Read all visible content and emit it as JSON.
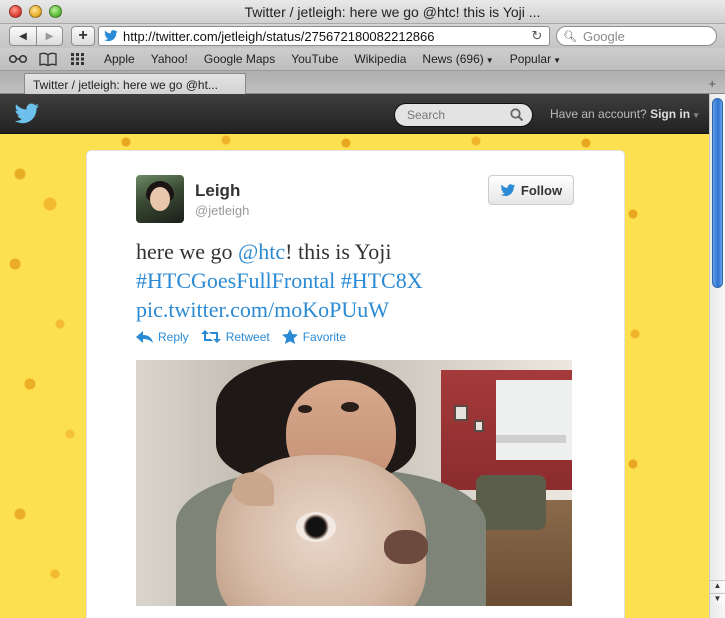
{
  "window": {
    "title": "Twitter / jetleigh: here we go @htc! this is Yoji ..."
  },
  "toolbar": {
    "back_icon": "back-arrow-icon",
    "forward_icon": "forward-arrow-icon",
    "add_icon": "+",
    "url": "http://twitter.com/jetleigh/status/275672180082212866",
    "search_placeholder": "Google"
  },
  "bookmarks": {
    "items": [
      {
        "label": "Apple"
      },
      {
        "label": "Yahoo!"
      },
      {
        "label": "Google Maps"
      },
      {
        "label": "YouTube"
      },
      {
        "label": "Wikipedia"
      },
      {
        "label": "News (696)"
      },
      {
        "label": "Popular"
      }
    ]
  },
  "tabs": [
    {
      "label": "Twitter / jetleigh: here we go @ht..."
    }
  ],
  "twitter": {
    "search_placeholder": "Search",
    "account_prompt": "Have an account?",
    "signin_label": "Sign in"
  },
  "tweet": {
    "name": "Leigh",
    "handle": "@jetleigh",
    "follow_label": "Follow",
    "text_plain1": "here we go ",
    "text_mention": "@htc",
    "text_plain2": "! this is Yoji",
    "hashtag1": "#HTCGoesFullFrontal",
    "hashtag2": "#HTC8X",
    "pic_link": "pic.twitter.com/moKoPUuW",
    "actions": {
      "reply": "Reply",
      "retweet": "Retweet",
      "favorite": "Favorite"
    }
  },
  "colors": {
    "link": "#2a8ad3",
    "page_bg": "#fde04f",
    "topbar": "#2b2b2b"
  }
}
